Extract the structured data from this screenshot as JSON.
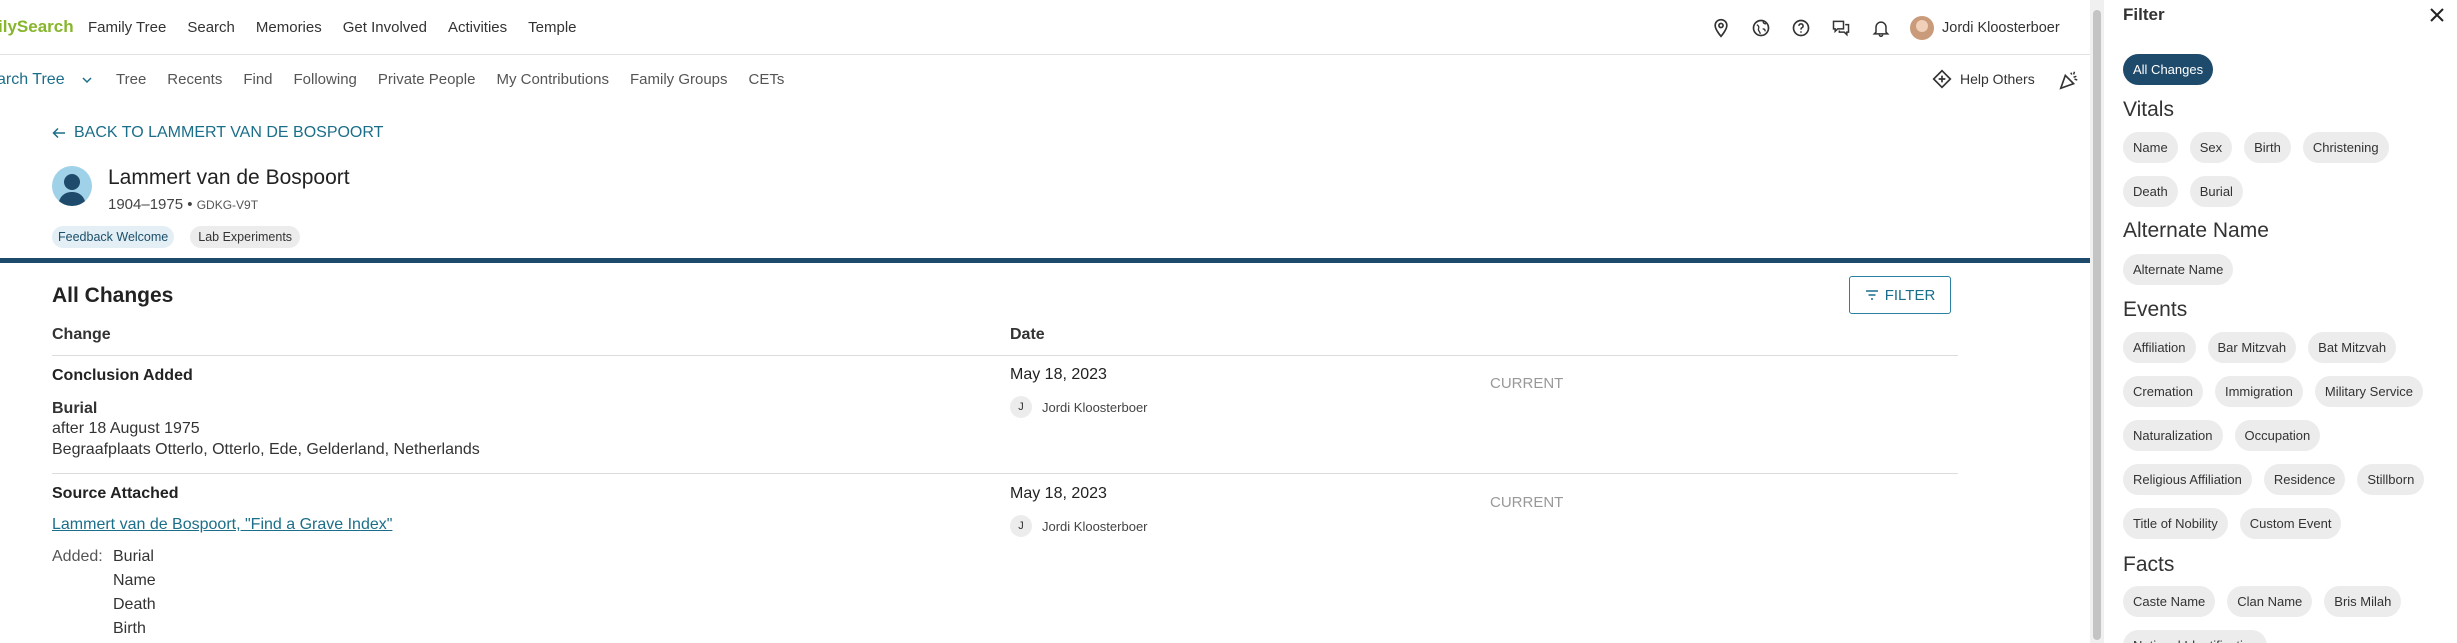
{
  "topnav": {
    "logo": "ilySearch",
    "links": [
      "Family Tree",
      "Search",
      "Memories",
      "Get Involved",
      "Activities",
      "Temple"
    ],
    "user_name": "Jordi Kloosterboer",
    "icons": [
      "location-pin-icon",
      "globe-icon",
      "help-icon",
      "chat-icon",
      "bell-icon"
    ]
  },
  "subnav": {
    "title": "arch Tree",
    "links": [
      "Tree",
      "Recents",
      "Find",
      "Following",
      "Private People",
      "My Contributions",
      "Family Groups",
      "CETs"
    ],
    "help_others": "Help Others"
  },
  "person": {
    "back_label": "BACK TO LAMMERT VAN DE BOSPOORT",
    "name": "Lammert van de Bospoort",
    "years": "1904–1975",
    "sep": "•",
    "pid": "GDKG-V9T",
    "badges": [
      "Feedback Welcome",
      "Lab Experiments"
    ]
  },
  "changes": {
    "title": "All Changes",
    "filter_label": "FILTER",
    "col_change": "Change",
    "col_date": "Date",
    "rows": [
      {
        "type": "Conclusion Added",
        "detail_title": "Burial",
        "detail_lines": [
          "after 18 August 1975",
          "Begraafplaats Otterlo, Otterlo, Ede, Gelderland, Netherlands"
        ],
        "date": "May 18, 2023",
        "contributor_initial": "J",
        "contributor": "Jordi Kloosterboer",
        "status": "CURRENT"
      },
      {
        "type": "Source Attached",
        "source_link": "Lammert van de Bospoort, \"Find a Grave Index\"",
        "added_label": "Added:",
        "added_items": [
          "Burial",
          "Name",
          "Death",
          "Birth"
        ],
        "date": "May 18, 2023",
        "contributor_initial": "J",
        "contributor": "Jordi Kloosterboer",
        "status": "CURRENT"
      }
    ]
  },
  "filter_panel": {
    "title": "Filter",
    "all_changes": "All Changes",
    "sections": [
      {
        "heading": "Vitals",
        "chips": [
          "Name",
          "Sex",
          "Birth",
          "Christening",
          "Death",
          "Burial"
        ]
      },
      {
        "heading": "Alternate Name",
        "chips": [
          "Alternate Name"
        ]
      },
      {
        "heading": "Events",
        "chips": [
          "Affiliation",
          "Bar Mitzvah",
          "Bat Mitzvah",
          "Cremation",
          "Immigration",
          "Military Service",
          "Naturalization",
          "Occupation",
          "Religious Affiliation",
          "Residence",
          "Stillborn",
          "Title of Nobility",
          "Custom Event"
        ]
      },
      {
        "heading": "Facts",
        "chips": [
          "Caste Name",
          "Clan Name",
          "Bris Milah",
          "National Identification"
        ]
      }
    ]
  },
  "colors": {
    "accent": "#1b6e8a",
    "banner": "#1e4a6b",
    "logo_green": "#87b52b"
  }
}
